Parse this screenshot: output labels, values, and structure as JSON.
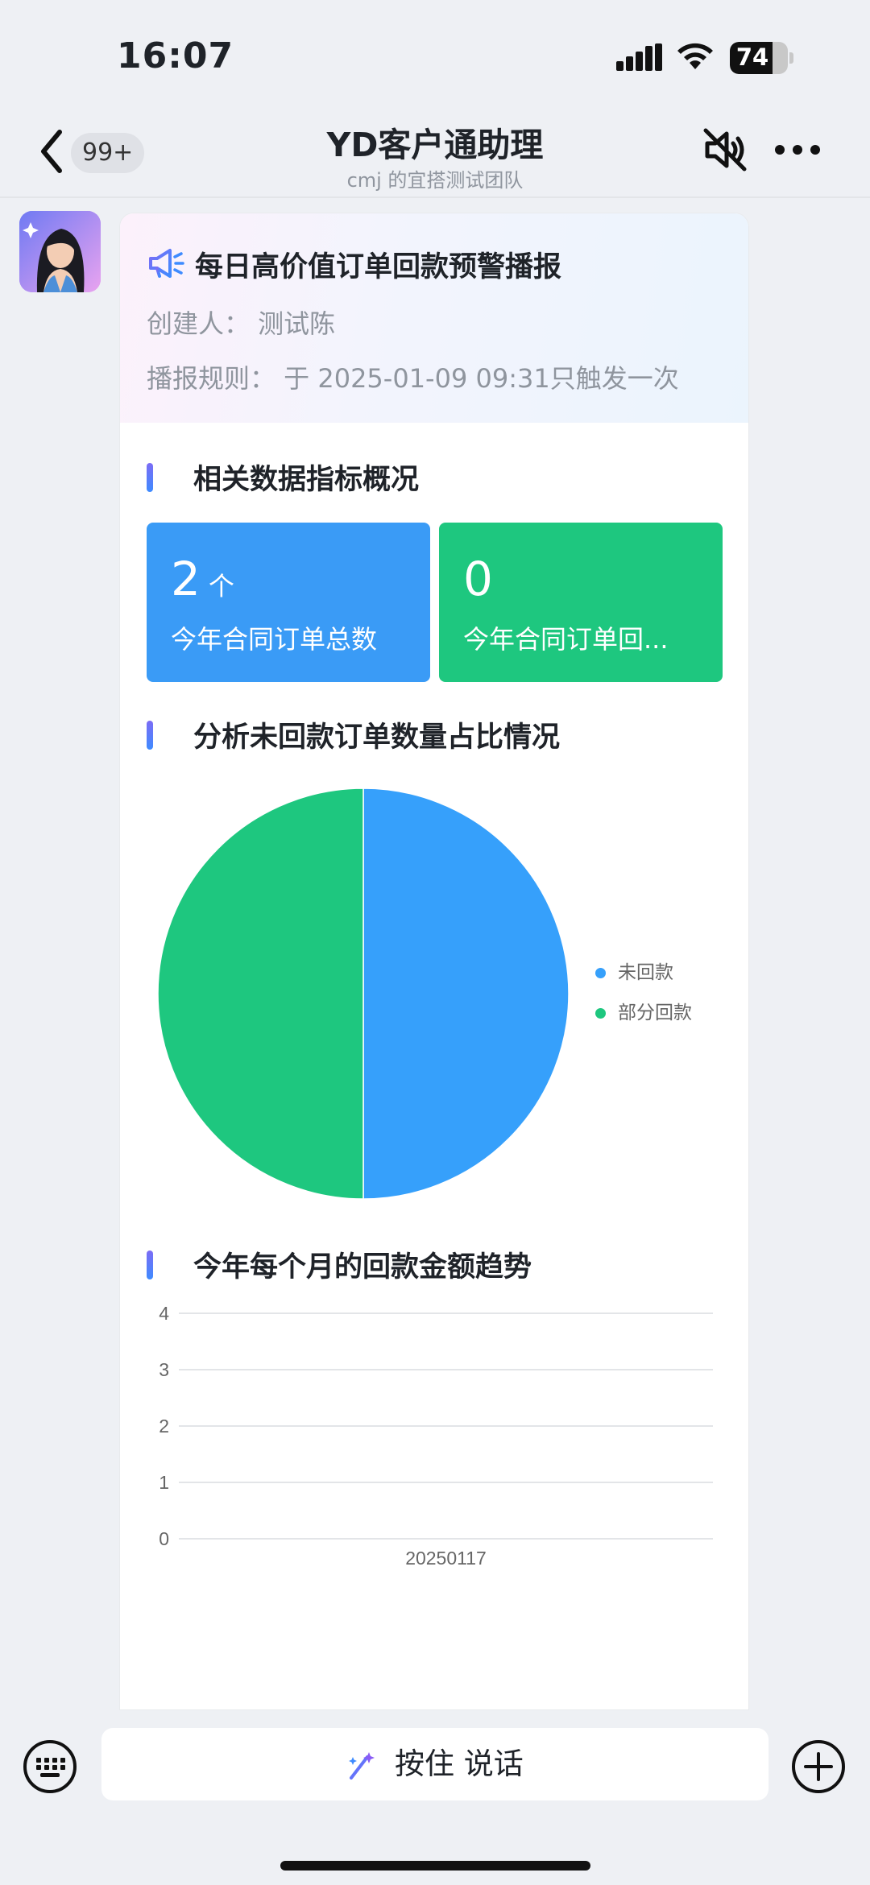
{
  "status": {
    "time": "16:07",
    "battery": "74",
    "battery_level": 0.74
  },
  "nav": {
    "back_badge": "99+",
    "title": "YD客户通助理",
    "subtitle": "cmj 的宜搭测试团队"
  },
  "card": {
    "title": "每日高价值订单回款预警播报",
    "creator": "创建人：  测试陈",
    "rule": "播报规则：  于 2025-01-09 09:31只触发一次"
  },
  "overview": {
    "title": "相关数据指标概况",
    "kpis": [
      {
        "value": "2",
        "unit": "个",
        "label": "今年合同订单总数"
      },
      {
        "value": "0",
        "unit": "",
        "label": "今年合同订单回..."
      }
    ]
  },
  "pie": {
    "title": "分析未回款订单数量占比情况"
  },
  "trend": {
    "title": "今年每个月的回款金额趋势"
  },
  "chart_data": [
    {
      "type": "pie",
      "title": "分析未回款订单数量占比情况",
      "slices": [
        {
          "name": "未回款",
          "value": 1,
          "color": "#36a0fb"
        },
        {
          "name": "部分回款",
          "value": 1,
          "color": "#1ec77f"
        }
      ],
      "legend": "right"
    },
    {
      "type": "line",
      "title": "今年每个月的回款金额趋势",
      "x": [
        "20250117"
      ],
      "series": [
        {
          "values": []
        }
      ],
      "y_ticks": [
        "0",
        "1",
        "2",
        "3",
        "4"
      ],
      "ylim": [
        0,
        4
      ],
      "grid": true
    }
  ],
  "bottom": {
    "hold_label": "按住 说话"
  }
}
